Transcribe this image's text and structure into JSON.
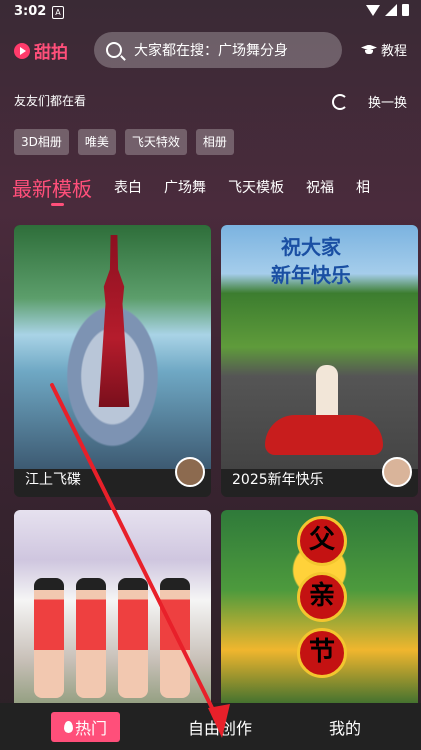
{
  "status_bar": {
    "time": "3:02",
    "notif_letter": "A"
  },
  "header": {
    "app_name": "甜拍",
    "search_placeholder": "大家都在搜：广场舞分身",
    "tutorial_label": "教程"
  },
  "friends": {
    "label": "友友们都在看",
    "refresh_label": "换一换"
  },
  "tags": [
    "3D相册",
    "唯美",
    "飞天特效",
    "相册"
  ],
  "tabs": [
    "最新模板",
    "表白",
    "广场舞",
    "飞天模板",
    "祝福",
    "相"
  ],
  "cards": [
    {
      "title": "江上飞碟"
    },
    {
      "title": "2025新年快乐",
      "greeting_line1": "祝大家",
      "greeting_line2": "新年快乐"
    },
    {
      "title": ""
    },
    {
      "title": "",
      "medallions": [
        "父",
        "亲",
        "节"
      ]
    }
  ],
  "bottom_nav": {
    "hot": "热门",
    "create": "自由创作",
    "mine": "我的"
  },
  "colors": {
    "accent": "#ff4f7a",
    "arrow": "#e8202a"
  }
}
